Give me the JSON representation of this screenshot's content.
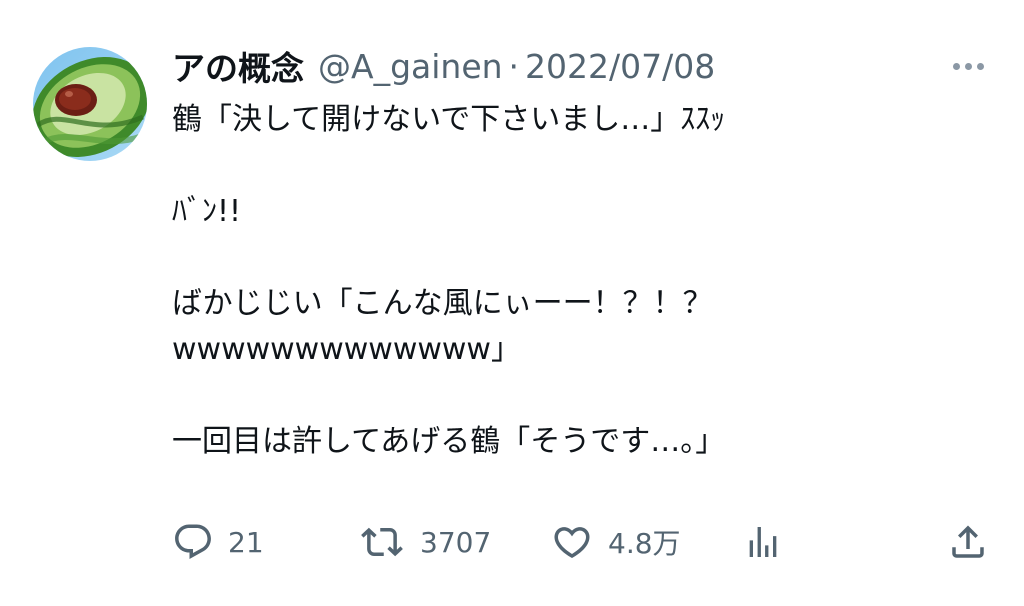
{
  "tweet": {
    "display_name": "アの概念",
    "handle": "@A_gainen",
    "separator": "·",
    "date": "2022/07/08",
    "more_icon": "more-horizontal-icon",
    "lines": [
      "鶴「決して開けないで下さいまし…」ｽｽｯ",
      "",
      "ﾊﾞﾝ!!",
      "",
      "ばかじじい「こんな風にぃーー！？！？",
      "wwwwwwwwwwwww」",
      "",
      "一回目は許してあげる鶴「そうです…。」"
    ]
  },
  "actions": {
    "reply": {
      "icon": "reply-icon",
      "count": "21"
    },
    "retweet": {
      "icon": "retweet-icon",
      "count": "3707"
    },
    "like": {
      "icon": "heart-icon",
      "count": "4.8万"
    },
    "views": {
      "icon": "views-bar-chart-icon"
    },
    "share": {
      "icon": "share-icon"
    }
  },
  "colors": {
    "text_primary": "#0f1419",
    "text_secondary": "#536471",
    "background": "#ffffff"
  }
}
